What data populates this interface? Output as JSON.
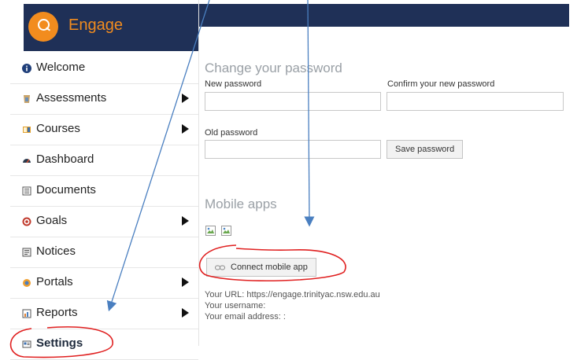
{
  "app": {
    "name": "Engage"
  },
  "sidebar": {
    "items": [
      {
        "label": "Welcome",
        "icon": "info-icon",
        "has_arrow": false
      },
      {
        "label": "Assessments",
        "icon": "assessment-icon",
        "has_arrow": true
      },
      {
        "label": "Courses",
        "icon": "courses-icon",
        "has_arrow": true
      },
      {
        "label": "Dashboard",
        "icon": "dashboard-icon",
        "has_arrow": false
      },
      {
        "label": "Documents",
        "icon": "documents-icon",
        "has_arrow": false
      },
      {
        "label": "Goals",
        "icon": "goals-icon",
        "has_arrow": true
      },
      {
        "label": "Notices",
        "icon": "notices-icon",
        "has_arrow": false
      },
      {
        "label": "Portals",
        "icon": "portals-icon",
        "has_arrow": true
      },
      {
        "label": "Reports",
        "icon": "reports-icon",
        "has_arrow": true
      },
      {
        "label": "Settings",
        "icon": "settings-icon",
        "has_arrow": false,
        "active": true
      }
    ]
  },
  "password": {
    "heading": "Change your password",
    "new_label": "New password",
    "confirm_label": "Confirm your new password",
    "old_label": "Old password",
    "save_label": "Save password"
  },
  "mobile": {
    "heading": "Mobile apps",
    "connect_label": "Connect mobile app",
    "url_line": "Your URL: https://engage.trinityac.nsw.edu.au",
    "username_line": "Your username:",
    "email_line": "Your email address: :"
  },
  "colors": {
    "header": "#1f3057",
    "brand_orange": "#f28c1e",
    "arrow_blue": "#4a7fc0",
    "annotation_red": "#e02020"
  }
}
